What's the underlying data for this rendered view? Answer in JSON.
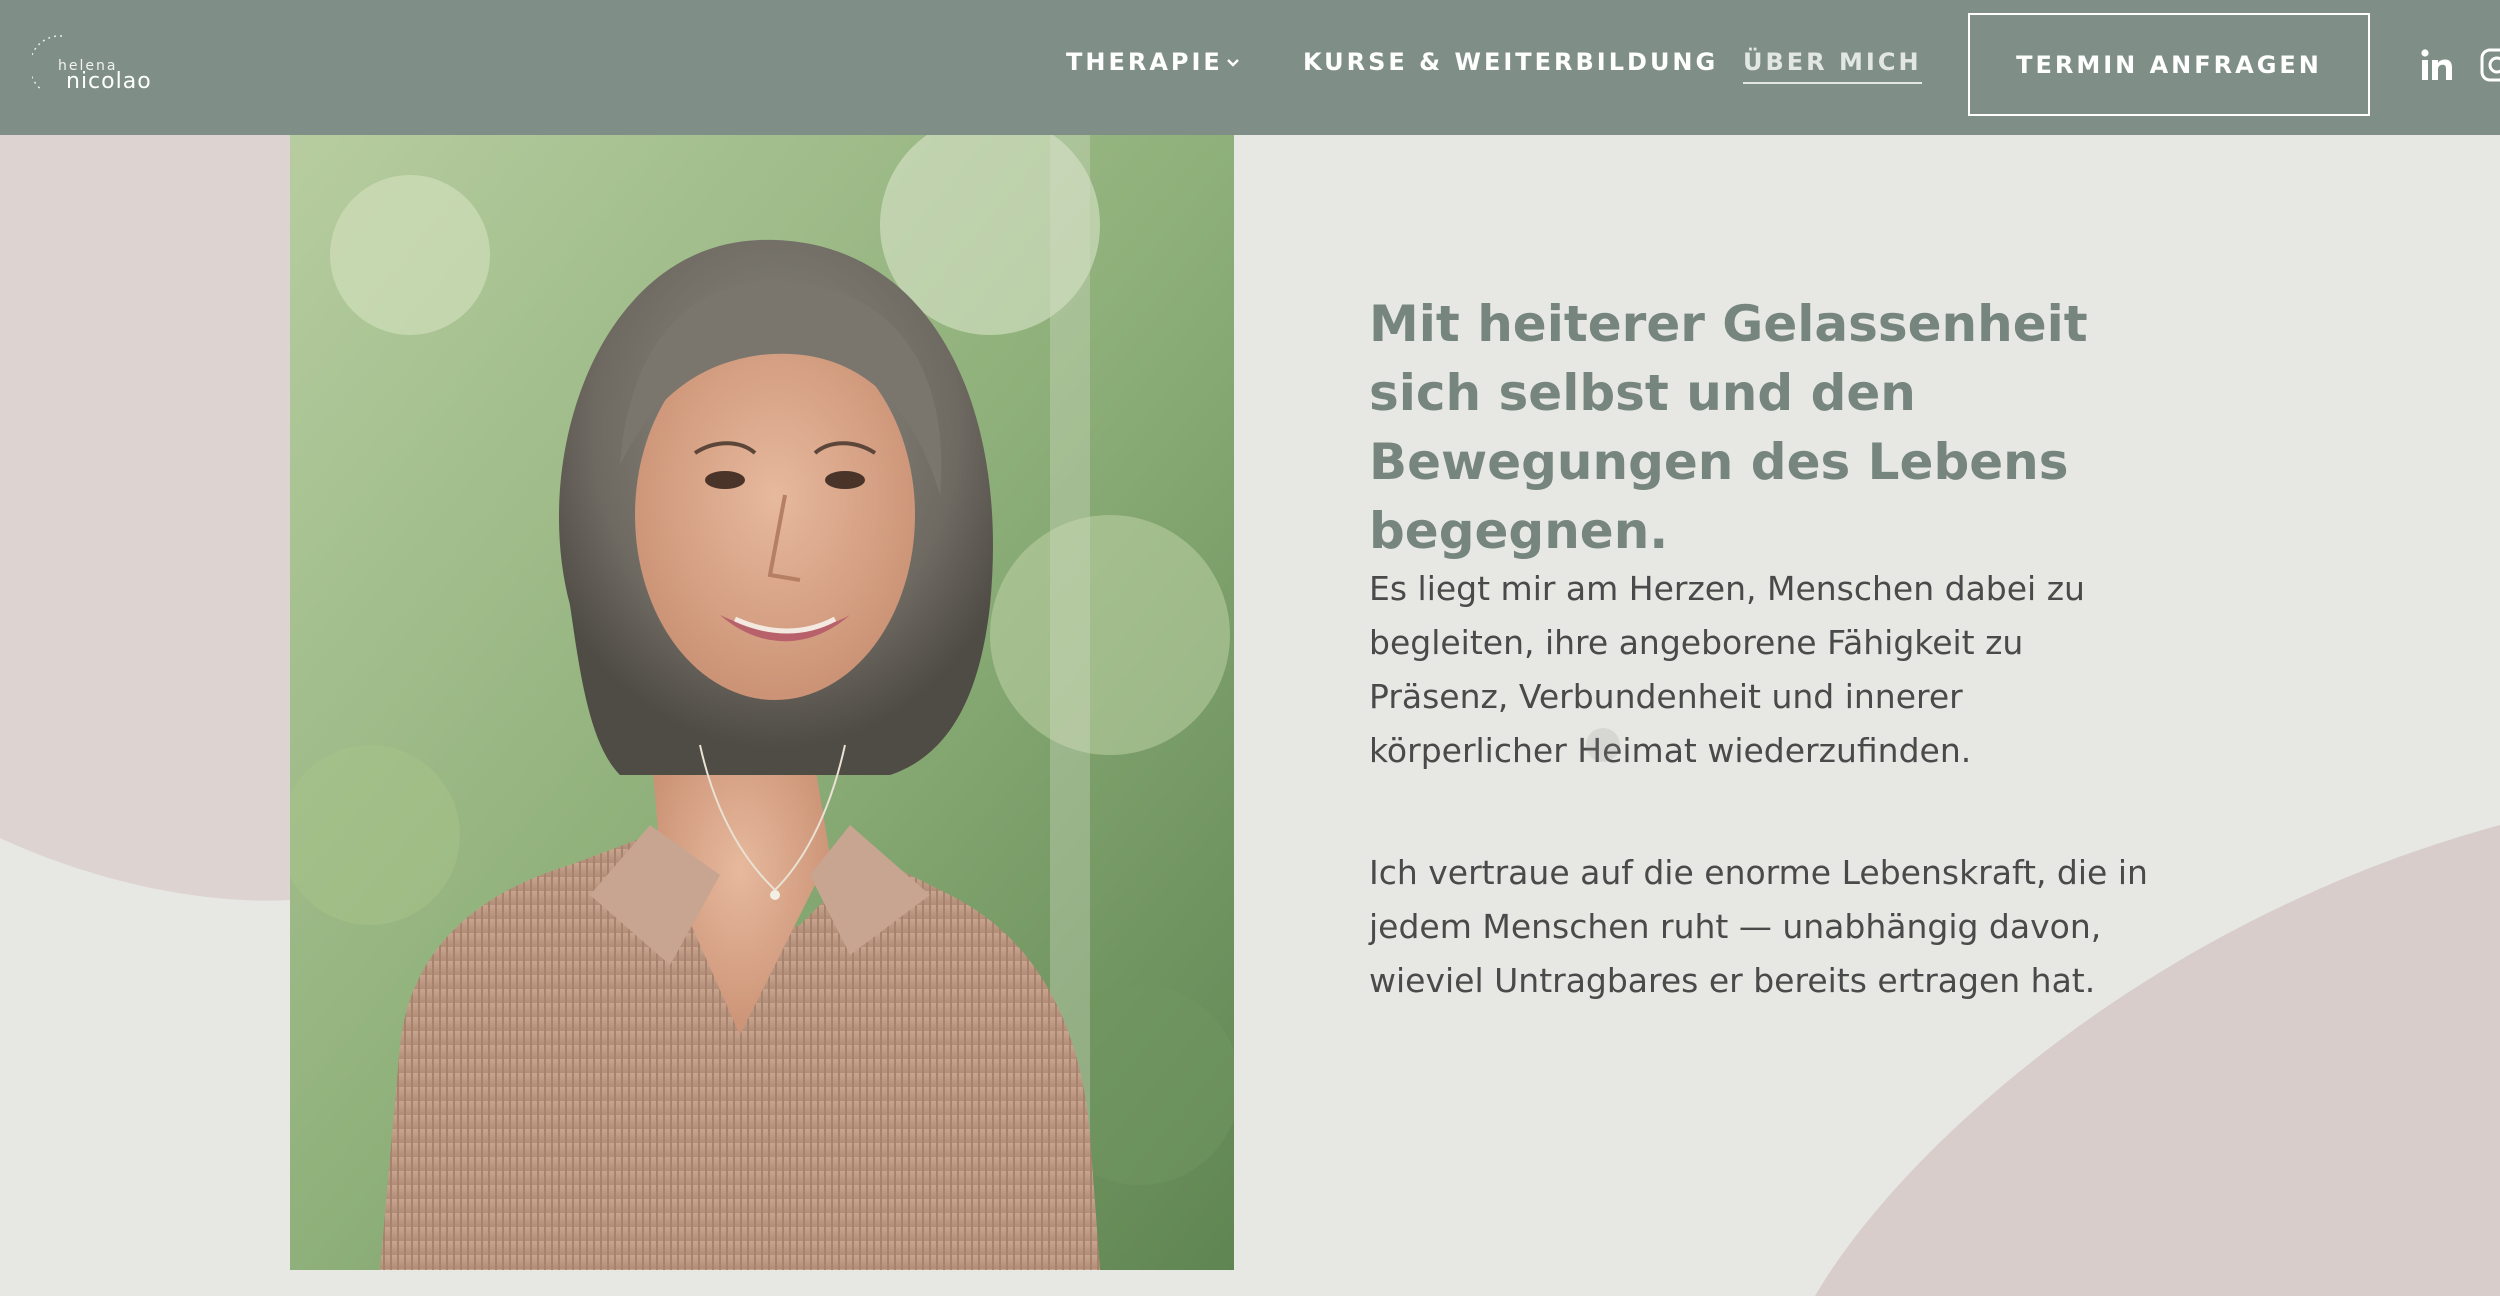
{
  "header": {
    "logo": {
      "arc_text": "SHARING LIGHT",
      "small": "helena",
      "big": "nicolao"
    },
    "nav": {
      "therapie": "THERAPIE",
      "kurse": "KURSE & WEITERBILDUNG",
      "ueber": "ÜBER MICH"
    },
    "cta_label": "TERMIN ANFRAGEN",
    "social_icons": [
      "linkedin-icon",
      "instagram-icon"
    ]
  },
  "main": {
    "headline": "Mit heiterer Gelassenheit sich selbst und den Bewegungen des Lebens begegnen.",
    "paragraph_1": "Es liegt mir am Herzen, Menschen dabei zu begleiten, ihre angeborene Fähigkeit zu Präsenz, Verbundenheit und innerer körperlicher Heimat wiederzufinden.",
    "paragraph_2": "Ich vertraue auf die enorme Lebenskraft, die in jedem Menschen ruht — unabhängig davon, wieviel Untragbares er bereits ertragen hat."
  },
  "colors": {
    "header_bg": "#7f8f88",
    "page_bg": "#e7e8e3",
    "blob": "#ddd4d2",
    "headline": "#76857d",
    "body_text": "#4a4a4a"
  }
}
